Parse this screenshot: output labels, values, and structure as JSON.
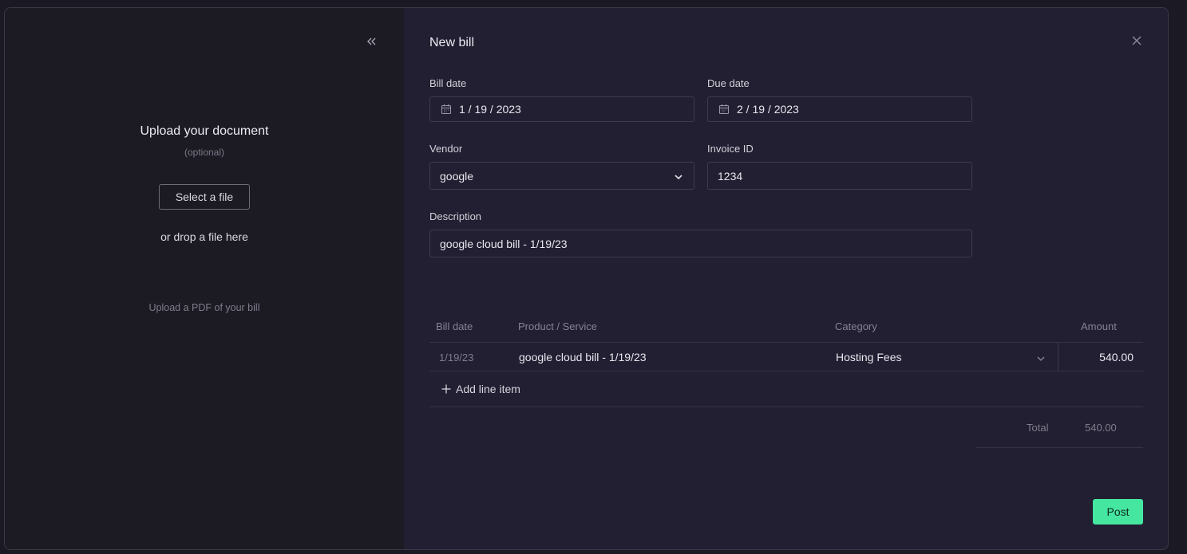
{
  "upload": {
    "title": "Upload your document",
    "optional": "(optional)",
    "select_button": "Select a file",
    "drop_text": "or drop a file here",
    "hint": "Upload a PDF of your bill",
    "collapse_icon": "double-chevron-left-icon"
  },
  "form": {
    "title": "New bill",
    "close_icon": "close-icon",
    "bill_date": {
      "label": "Bill date",
      "value": "1 / 19 / 2023"
    },
    "due_date": {
      "label": "Due date",
      "value": "2 / 19 / 2023"
    },
    "vendor": {
      "label": "Vendor",
      "value": "google"
    },
    "invoice_id": {
      "label": "Invoice ID",
      "value": "1234"
    },
    "description": {
      "label": "Description",
      "value": "google cloud bill - 1/19/23"
    }
  },
  "lines": {
    "headers": {
      "date": "Bill date",
      "product": "Product / Service",
      "category": "Category",
      "amount": "Amount"
    },
    "rows": [
      {
        "date": "1/19/23",
        "product": "google cloud bill - 1/19/23",
        "category": "Hosting Fees",
        "amount": "540.00"
      }
    ],
    "add_label": "Add line item",
    "total_label": "Total",
    "total_value": "540.00"
  },
  "actions": {
    "post_label": "Post"
  },
  "colors": {
    "accent": "#45e6a0",
    "panel": "#1c1b23",
    "background": "#221f32"
  }
}
